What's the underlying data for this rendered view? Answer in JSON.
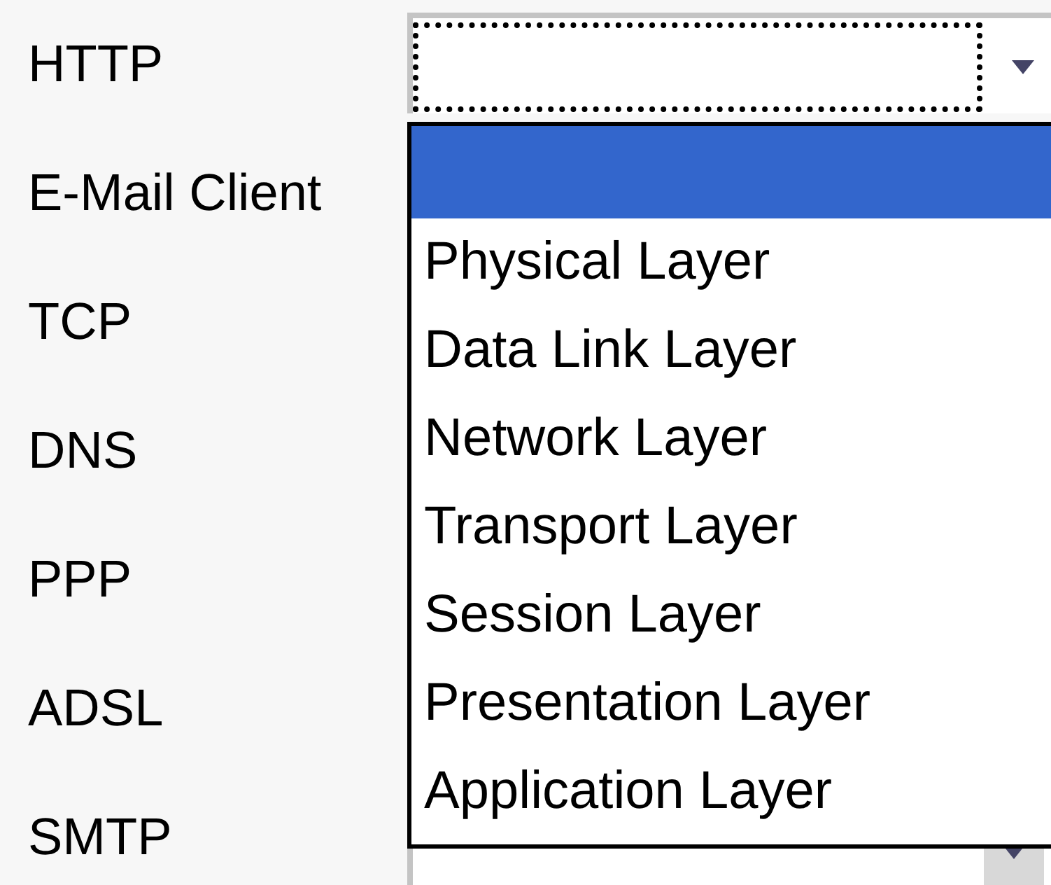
{
  "rows": [
    {
      "label": "HTTP",
      "expanded": true,
      "focused": true
    },
    {
      "label": "E-Mail Client"
    },
    {
      "label": "TCP"
    },
    {
      "label": "DNS"
    },
    {
      "label": "PPP"
    },
    {
      "label": "ADSL"
    },
    {
      "label": "SMTP",
      "expanded": false,
      "focused": false
    }
  ],
  "dropdown_list": {
    "options": [
      {
        "selected": true
      },
      {
        "label": "Physical Layer",
        "selected": false
      },
      {
        "label": "Data Link Layer",
        "selected": false
      },
      {
        "label": "Network Layer",
        "selected": false
      },
      {
        "label": "Transport Layer",
        "selected": false
      },
      {
        "label": "Session Layer",
        "selected": false
      },
      {
        "label": "Presentation Layer",
        "selected": false
      },
      {
        "label": "Application Layer",
        "selected": false
      }
    ]
  }
}
